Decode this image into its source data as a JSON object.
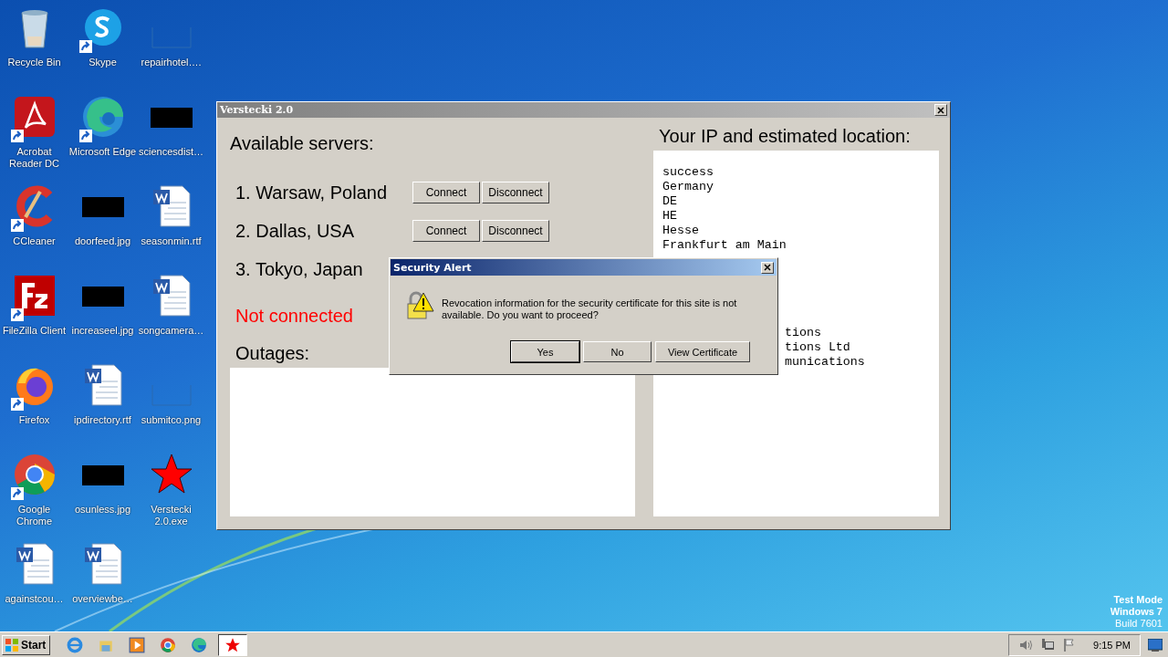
{
  "desktop_icons": [
    {
      "label": "Recycle Bin",
      "kind": "recycle",
      "shortcut": false
    },
    {
      "label": "Acrobat Reader DC",
      "kind": "acrobat",
      "shortcut": true
    },
    {
      "label": "CCleaner",
      "kind": "ccleaner",
      "shortcut": true
    },
    {
      "label": "FileZilla Client",
      "kind": "filezilla",
      "shortcut": true
    },
    {
      "label": "Firefox",
      "kind": "firefox",
      "shortcut": true
    },
    {
      "label": "Google Chrome",
      "kind": "chrome",
      "shortcut": true
    },
    {
      "label": "againstcou…",
      "kind": "word",
      "shortcut": false
    },
    {
      "label": "Skype",
      "kind": "skype",
      "shortcut": true
    },
    {
      "label": "Microsoft Edge",
      "kind": "edge",
      "shortcut": true
    },
    {
      "label": "doorfeed.jpg",
      "kind": "image",
      "shortcut": false
    },
    {
      "label": "increaseel.jpg",
      "kind": "image",
      "shortcut": false
    },
    {
      "label": "ipdirectory.rtf",
      "kind": "word",
      "shortcut": false
    },
    {
      "label": "osunless.jpg",
      "kind": "image",
      "shortcut": false
    },
    {
      "label": "overviewbe…",
      "kind": "word",
      "shortcut": false
    },
    {
      "label": "repairhotel….",
      "kind": "blank",
      "shortcut": false
    },
    {
      "label": "sciencesdist…",
      "kind": "image",
      "shortcut": false
    },
    {
      "label": "seasonmin.rtf",
      "kind": "word",
      "shortcut": false
    },
    {
      "label": "songcamera…",
      "kind": "word",
      "shortcut": false
    },
    {
      "label": "submitco.png",
      "kind": "blank",
      "shortcut": false
    },
    {
      "label": "Verstecki 2.0.exe",
      "kind": "star",
      "shortcut": false
    }
  ],
  "window": {
    "title": "Verstecki 2.0",
    "servers_heading": "Available servers:",
    "servers": [
      {
        "name": "1. Warsaw, Poland",
        "buttons": [
          "Connect",
          "Disconnect"
        ]
      },
      {
        "name": "2. Dallas, USA",
        "buttons": [
          "Connect",
          "Disconnect"
        ]
      },
      {
        "name": "3. Tokyo, Japan"
      }
    ],
    "status": {
      "text": "Not connected",
      "connected": false
    },
    "outages_heading": "Outages:",
    "ip_heading": "Your IP and estimated location:",
    "ip_lines": [
      "success",
      "Germany",
      "DE",
      "HE",
      "Hesse",
      "Frankfurt am Main"
    ],
    "ip_lines_partly_covered": [
      "tions",
      "tions Ltd",
      "munications"
    ]
  },
  "dialog": {
    "title": "Security Alert",
    "message": "Revocation information for the security certificate for this site is not available. Do you want to proceed?",
    "buttons": [
      {
        "label": "Yes",
        "default": true
      },
      {
        "label": "No",
        "default": false
      },
      {
        "label": "View Certificate",
        "default": false
      }
    ]
  },
  "os_info": [
    "Test Mode",
    "Windows 7",
    "Build 7601"
  ],
  "taskbar": {
    "start": "Start",
    "items": [
      {
        "kind": "ie",
        "active": false
      },
      {
        "kind": "explorer",
        "active": false
      },
      {
        "kind": "media",
        "active": false
      },
      {
        "kind": "chrome",
        "active": false
      },
      {
        "kind": "edge",
        "active": false
      },
      {
        "kind": "star",
        "active": true
      }
    ],
    "clock": "9:15 PM"
  }
}
